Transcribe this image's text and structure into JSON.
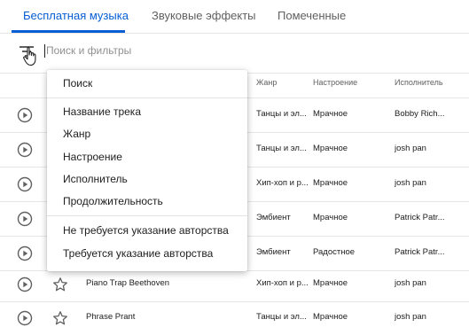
{
  "tabs": [
    "Бесплатная музыка",
    "Звуковые эффекты",
    "Помеченные"
  ],
  "search": {
    "placeholder": "Поиск и фильтры",
    "value": ""
  },
  "table": {
    "headers": {
      "genre": "Жанр",
      "mood": "Настроение",
      "artist": "Исполнитель"
    },
    "rows": [
      {
        "title": "",
        "genre": "Танцы и эл...",
        "mood": "Мрачное",
        "artist": "Bobby Rich..."
      },
      {
        "title": "",
        "genre": "Танцы и эл...",
        "mood": "Мрачное",
        "artist": "josh pan"
      },
      {
        "title": "",
        "genre": "Хип-хоп и р...",
        "mood": "Мрачное",
        "artist": "josh pan"
      },
      {
        "title": "",
        "genre": "Эмбиент",
        "mood": "Мрачное",
        "artist": "Patrick Patr..."
      },
      {
        "title": "",
        "genre": "Эмбиент",
        "mood": "Радостное",
        "artist": "Patrick Patr..."
      },
      {
        "title": "Piano Trap Beethoven",
        "genre": "Хип-хоп и р...",
        "mood": "Мрачное",
        "artist": "josh pan"
      },
      {
        "title": "Phrase Prant",
        "genre": "Танцы и эл...",
        "mood": "Мрачное",
        "artist": "josh pan"
      }
    ]
  },
  "filter_menu": {
    "search": "Поиск",
    "fields": [
      "Название трека",
      "Жанр",
      "Настроение",
      "Исполнитель",
      "Продолжительность"
    ],
    "attribution": [
      "Не требуется указание авторства",
      "Требуется указание авторства"
    ]
  },
  "colors": {
    "accent": "#065fd4",
    "text": "#202020",
    "muted": "#606060",
    "divider": "#e6e6e6"
  }
}
